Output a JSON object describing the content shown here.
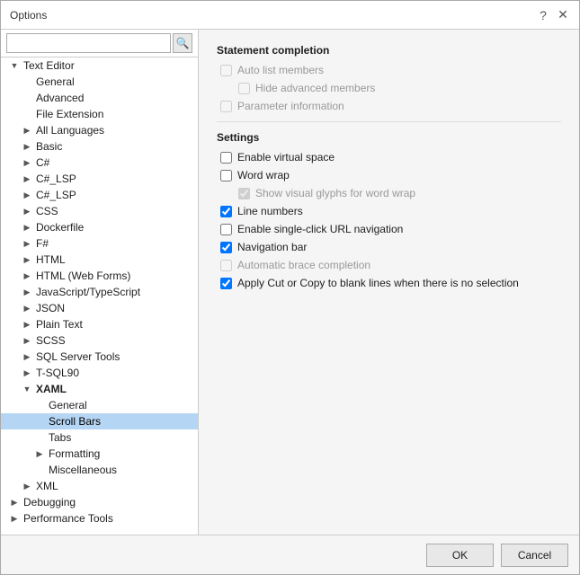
{
  "dialog": {
    "title": "Options",
    "help_btn": "?",
    "close_btn": "✕"
  },
  "search": {
    "placeholder": "",
    "icon": "🔍"
  },
  "tree": {
    "items": [
      {
        "id": "text-editor",
        "label": "Text Editor",
        "level": 1,
        "arrow": "▼",
        "selected": false
      },
      {
        "id": "general",
        "label": "General",
        "level": 2,
        "arrow": "",
        "selected": false
      },
      {
        "id": "advanced",
        "label": "Advanced",
        "level": 2,
        "arrow": "",
        "selected": false
      },
      {
        "id": "file-extension",
        "label": "File Extension",
        "level": 2,
        "arrow": "",
        "selected": false
      },
      {
        "id": "all-languages",
        "label": "All Languages",
        "level": 2,
        "arrow": "▶",
        "selected": false
      },
      {
        "id": "basic",
        "label": "Basic",
        "level": 2,
        "arrow": "▶",
        "selected": false
      },
      {
        "id": "c-sharp",
        "label": "C#",
        "level": 2,
        "arrow": "▶",
        "selected": false
      },
      {
        "id": "c-lsp",
        "label": "C#_LSP",
        "level": 2,
        "arrow": "▶",
        "selected": false
      },
      {
        "id": "c-lsp2",
        "label": "C#_LSP",
        "level": 2,
        "arrow": "▶",
        "selected": false
      },
      {
        "id": "css",
        "label": "CSS",
        "level": 2,
        "arrow": "▶",
        "selected": false
      },
      {
        "id": "dockerfile",
        "label": "Dockerfile",
        "level": 2,
        "arrow": "▶",
        "selected": false
      },
      {
        "id": "fsharp",
        "label": "F#",
        "level": 2,
        "arrow": "▶",
        "selected": false
      },
      {
        "id": "html",
        "label": "HTML",
        "level": 2,
        "arrow": "▶",
        "selected": false
      },
      {
        "id": "html-webforms",
        "label": "HTML (Web Forms)",
        "level": 2,
        "arrow": "▶",
        "selected": false
      },
      {
        "id": "javascript-typescript",
        "label": "JavaScript/TypeScript",
        "level": 2,
        "arrow": "▶",
        "selected": false
      },
      {
        "id": "json",
        "label": "JSON",
        "level": 2,
        "arrow": "▶",
        "selected": false
      },
      {
        "id": "plain-text",
        "label": "Plain Text",
        "level": 2,
        "arrow": "▶",
        "selected": false
      },
      {
        "id": "scss",
        "label": "SCSS",
        "level": 2,
        "arrow": "▶",
        "selected": false
      },
      {
        "id": "sql-server-tools",
        "label": "SQL Server Tools",
        "level": 2,
        "arrow": "▶",
        "selected": false
      },
      {
        "id": "t-sql90",
        "label": "T-SQL90",
        "level": 2,
        "arrow": "▶",
        "selected": false
      },
      {
        "id": "xaml",
        "label": "XAML",
        "level": 2,
        "arrow": "▼",
        "selected": true
      },
      {
        "id": "xaml-general",
        "label": "General",
        "level": 3,
        "arrow": "",
        "selected": false
      },
      {
        "id": "xaml-scrollbars",
        "label": "Scroll Bars",
        "level": 3,
        "arrow": "",
        "selected": false,
        "active": true
      },
      {
        "id": "xaml-tabs",
        "label": "Tabs",
        "level": 3,
        "arrow": "",
        "selected": false
      },
      {
        "id": "xaml-formatting",
        "label": "Formatting",
        "level": 3,
        "arrow": "▶",
        "selected": false
      },
      {
        "id": "xaml-miscellaneous",
        "label": "Miscellaneous",
        "level": 3,
        "arrow": "",
        "selected": false
      },
      {
        "id": "xml",
        "label": "XML",
        "level": 2,
        "arrow": "▶",
        "selected": false
      },
      {
        "id": "debugging",
        "label": "Debugging",
        "level": 1,
        "arrow": "▶",
        "selected": false
      },
      {
        "id": "performance-tools",
        "label": "Performance Tools",
        "level": 1,
        "arrow": "▶",
        "selected": false
      }
    ]
  },
  "content": {
    "statement_completion_title": "Statement completion",
    "options": [
      {
        "id": "auto-list",
        "label": "Auto list members",
        "checked": false,
        "disabled": true,
        "indented": false
      },
      {
        "id": "hide-advanced",
        "label": "Hide advanced members",
        "checked": false,
        "disabled": true,
        "indented": true
      },
      {
        "id": "parameter-info",
        "label": "Parameter information",
        "checked": false,
        "disabled": true,
        "indented": false
      }
    ],
    "settings_title": "Settings",
    "settings": [
      {
        "id": "virtual-space",
        "label": "Enable virtual space",
        "checked": false,
        "disabled": false,
        "indented": false
      },
      {
        "id": "word-wrap",
        "label": "Word wrap",
        "checked": false,
        "disabled": false,
        "indented": false
      },
      {
        "id": "visual-glyphs",
        "label": "Show visual glyphs for word wrap",
        "checked": true,
        "disabled": true,
        "indented": true
      },
      {
        "id": "line-numbers",
        "label": "Line numbers",
        "checked": true,
        "disabled": false,
        "indented": false
      },
      {
        "id": "single-click-url",
        "label": "Enable single-click URL navigation",
        "checked": false,
        "disabled": false,
        "indented": false
      },
      {
        "id": "nav-bar",
        "label": "Navigation bar",
        "checked": true,
        "disabled": false,
        "indented": false
      },
      {
        "id": "auto-brace",
        "label": "Automatic brace completion",
        "checked": false,
        "disabled": true,
        "indented": false
      },
      {
        "id": "cut-copy",
        "label": "Apply Cut or Copy to blank lines when there is no selection",
        "checked": true,
        "disabled": false,
        "indented": false
      }
    ]
  },
  "buttons": {
    "ok": "OK",
    "cancel": "Cancel"
  }
}
